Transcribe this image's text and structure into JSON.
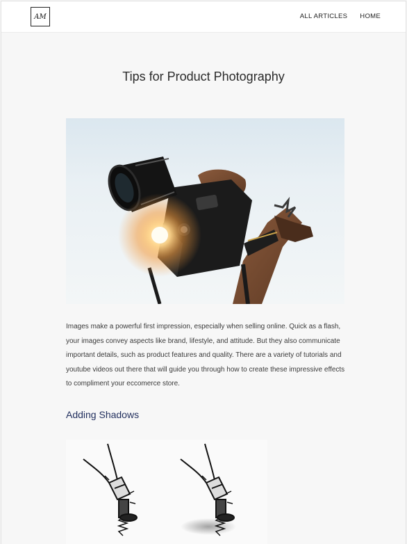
{
  "header": {
    "logo_text": "AM",
    "nav": [
      {
        "label": "ALL ARTICLES"
      },
      {
        "label": "HOME"
      }
    ]
  },
  "article": {
    "title": "Tips for Product Photography",
    "hero_image": "camera held up against bright sky",
    "intro": "Images make a powerful first impression, especially when selling online. Quick as a flash, your images convey aspects like brand, lifestyle, and attitude. But they also communicate important details, such as product features and quality. There are a variety of tutorials and youtube videos out there that will guide you through how to create these impressive effects to compliment your eccomerce store.",
    "section_heading": "Adding Shadows",
    "section_image": "corkscrew without shadow and corkscrew with shadow"
  },
  "colors": {
    "heading_blue": "#1f2d5c",
    "text": "#3a3a3a",
    "background": "#f7f7f7"
  }
}
